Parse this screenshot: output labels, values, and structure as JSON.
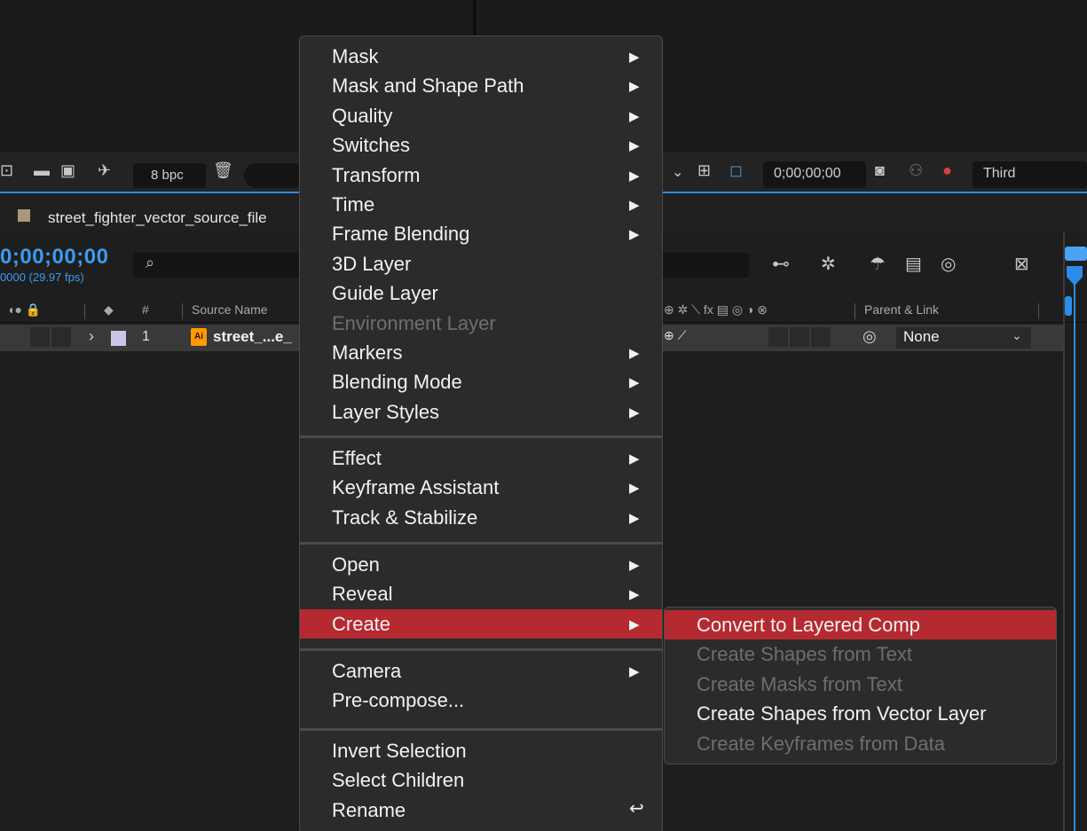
{
  "toolbar": {
    "bit_depth": "8bpc_placeholder",
    "bpc_label": "8 bpc",
    "timecode": "0;00;00;00",
    "view_mode": "Third",
    "icons": [
      "flowchart-icon",
      "folder-icon",
      "composition-icon",
      "render-icon",
      "trash-icon",
      "chevron-down-icon",
      "region-icon",
      "transparency-grid-icon",
      "camera-icon",
      "channel-icon",
      "color-icon"
    ]
  },
  "tab": {
    "comp_name": "street_fighter_vector_source_file"
  },
  "timeline": {
    "timecode": "0;00;00;00",
    "fps": "0000 (29.97 fps)",
    "search_glyph": "⌕",
    "columns": {
      "number": "#",
      "source_name": "Source Name",
      "parent_link": "Parent & Link"
    },
    "layer": {
      "number": "1",
      "name": "street_...e_",
      "parent": "None"
    }
  },
  "context_menu": {
    "groups": [
      [
        {
          "label": "Mask",
          "submenu": true,
          "enabled": true
        },
        {
          "label": "Mask and Shape Path",
          "submenu": true,
          "enabled": true
        },
        {
          "label": "Quality",
          "submenu": true,
          "enabled": true
        },
        {
          "label": "Switches",
          "submenu": true,
          "enabled": true
        },
        {
          "label": "Transform",
          "submenu": true,
          "enabled": true
        },
        {
          "label": "Time",
          "submenu": true,
          "enabled": true
        },
        {
          "label": "Frame Blending",
          "submenu": true,
          "enabled": true
        },
        {
          "label": "3D Layer",
          "submenu": false,
          "enabled": true
        },
        {
          "label": "Guide Layer",
          "submenu": false,
          "enabled": true
        },
        {
          "label": "Environment Layer",
          "submenu": false,
          "enabled": false
        },
        {
          "label": "Markers",
          "submenu": true,
          "enabled": true
        },
        {
          "label": "Blending Mode",
          "submenu": true,
          "enabled": true
        },
        {
          "label": "Layer Styles",
          "submenu": true,
          "enabled": true
        }
      ],
      [
        {
          "label": "Effect",
          "submenu": true,
          "enabled": true
        },
        {
          "label": "Keyframe Assistant",
          "submenu": true,
          "enabled": true
        },
        {
          "label": "Track & Stabilize",
          "submenu": true,
          "enabled": true
        }
      ],
      [
        {
          "label": "Open",
          "submenu": true,
          "enabled": true
        },
        {
          "label": "Reveal",
          "submenu": true,
          "enabled": true
        },
        {
          "label": "Create",
          "submenu": true,
          "enabled": true,
          "highlighted": true
        }
      ],
      [
        {
          "label": "Camera",
          "submenu": true,
          "enabled": true
        },
        {
          "label": "Pre-compose...",
          "submenu": false,
          "enabled": true
        }
      ],
      [
        {
          "label": "Invert Selection",
          "submenu": false,
          "enabled": true
        },
        {
          "label": "Select Children",
          "submenu": false,
          "enabled": true
        },
        {
          "label": "Rename",
          "submenu": false,
          "enabled": true,
          "shortcut": "↩"
        }
      ]
    ]
  },
  "create_submenu": [
    {
      "label": "Convert to Layered Comp",
      "enabled": true,
      "highlighted": true
    },
    {
      "label": "Create Shapes from Text",
      "enabled": false
    },
    {
      "label": "Create Masks from Text",
      "enabled": false
    },
    {
      "label": "Create Shapes from Vector Layer",
      "enabled": true
    },
    {
      "label": "Create Keyframes from Data",
      "enabled": false
    }
  ],
  "colors": {
    "highlight": "#b52a31",
    "timecode_blue": "#3a9bf0",
    "playhead_blue": "#2d8ceb"
  }
}
